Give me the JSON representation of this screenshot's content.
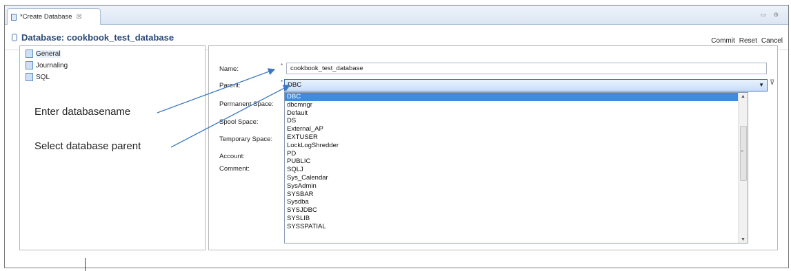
{
  "tab": {
    "title": "*Create Database",
    "close": "☒"
  },
  "window_controls": "▭ ⊕",
  "header": {
    "title": "Database: cookbook_test_database"
  },
  "actions": {
    "commit": "Commit",
    "reset": "Reset",
    "cancel": "Cancel"
  },
  "nav": {
    "items": [
      {
        "label": "General"
      },
      {
        "label": "Journaling"
      },
      {
        "label": "SQL"
      }
    ]
  },
  "annotations": {
    "enter_name": "Enter databasename",
    "select_parent": "Select database parent"
  },
  "form": {
    "name_label": "Name:",
    "name_value": "cookbook_test_database",
    "parent_label": "Parent:",
    "parent_value": "DBC",
    "permanent_space_label": "Permanent Space:",
    "spool_space_label": "Spool Space:",
    "temporary_space_label": "Temporary Space:",
    "account_label": "Account:",
    "comment_label": "Comment:",
    "required_mark": "*"
  },
  "dropdown": {
    "options": [
      "DBC",
      "dbcmngr",
      "Default",
      "DS",
      "External_AP",
      "EXTUSER",
      "LockLogShredder",
      "PD",
      "PUBLIC",
      "SQLJ",
      "Sys_Calendar",
      "SysAdmin",
      "SYSBAR",
      "Sysdba",
      "SYSJDBC",
      "SYSLIB",
      "SYSSPATIAL"
    ],
    "highlighted_index": 0
  },
  "icons": {
    "filter": "filter-icon",
    "dropdown_arrow": "chevron-down-icon"
  },
  "colors": {
    "header_title": "#2a4a78",
    "highlight": "#3f8cde",
    "annotation_arrow": "#3b78c4"
  }
}
